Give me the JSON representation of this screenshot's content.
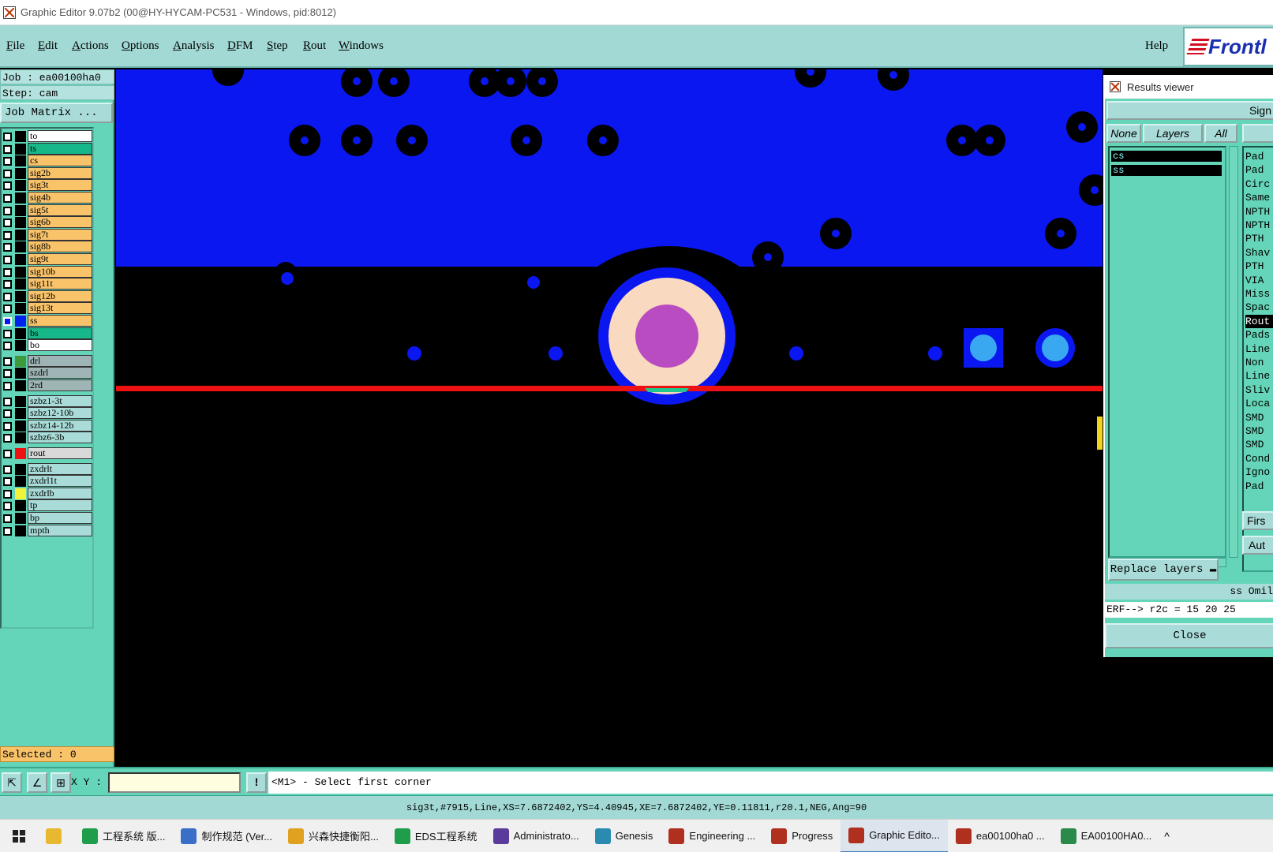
{
  "window": {
    "title": "Graphic Editor 9.07b2 (00@HY-HYCAM-PC531 - Windows, pid:8012)"
  },
  "menu": {
    "items": [
      "File",
      "Edit",
      "Actions",
      "Options",
      "Analysis",
      "DFM",
      "Step",
      "Rout",
      "Windows"
    ],
    "help": "Help",
    "brand": "Frontl"
  },
  "left_panel": {
    "job": "Job : ea00100ha0",
    "step": "Step: cam",
    "job_matrix": "Job Matrix ...",
    "selected": "Selected : 0",
    "layers": [
      {
        "name": "to",
        "bg": "#ffffff",
        "swatch": "#000000",
        "checked": false
      },
      {
        "name": "ts",
        "bg": "#16b88a",
        "swatch": "#000000",
        "checked": false
      },
      {
        "name": "cs",
        "bg": "#f9c36a",
        "swatch": "#000000",
        "checked": false
      },
      {
        "name": "sig2b",
        "bg": "#f9c36a",
        "swatch": "#000000",
        "checked": false
      },
      {
        "name": "sig3t",
        "bg": "#f9c36a",
        "swatch": "#000000",
        "checked": false
      },
      {
        "name": "sig4b",
        "bg": "#f9c36a",
        "swatch": "#000000",
        "checked": false
      },
      {
        "name": "sig5t",
        "bg": "#f9c36a",
        "swatch": "#000000",
        "checked": false
      },
      {
        "name": "sig6b",
        "bg": "#f9c36a",
        "swatch": "#000000",
        "checked": false
      },
      {
        "name": "sig7t",
        "bg": "#f9c36a",
        "swatch": "#000000",
        "checked": false
      },
      {
        "name": "sig8b",
        "bg": "#f9c36a",
        "swatch": "#000000",
        "checked": false
      },
      {
        "name": "sig9t",
        "bg": "#f9c36a",
        "swatch": "#000000",
        "checked": false
      },
      {
        "name": "sig10b",
        "bg": "#f9c36a",
        "swatch": "#000000",
        "checked": false
      },
      {
        "name": "sig11t",
        "bg": "#f9c36a",
        "swatch": "#000000",
        "checked": false
      },
      {
        "name": "sig12b",
        "bg": "#f9c36a",
        "swatch": "#000000",
        "checked": false
      },
      {
        "name": "sig13t",
        "bg": "#f9c36a",
        "swatch": "#000000",
        "checked": false
      },
      {
        "name": "ss",
        "bg": "#f9c36a",
        "swatch": "#0022ee",
        "checked": true
      },
      {
        "name": "bs",
        "bg": "#16b88a",
        "swatch": "#000000",
        "checked": false
      },
      {
        "name": "bo",
        "bg": "#ffffff",
        "swatch": "#000000",
        "checked": false
      },
      {
        "name": "drl",
        "bg": "#9fb5b5",
        "swatch": "#3c9a3c",
        "checked": false
      },
      {
        "name": "szdrl",
        "bg": "#9fb5b5",
        "swatch": "#000000",
        "checked": false
      },
      {
        "name": "2rd",
        "bg": "#9fb5b5",
        "swatch": "#000000",
        "checked": false
      },
      {
        "name": "szbz1-3t",
        "bg": "#a9dcd8",
        "swatch": "#000000",
        "checked": false
      },
      {
        "name": "szbz12-10b",
        "bg": "#a9dcd8",
        "swatch": "#000000",
        "checked": false
      },
      {
        "name": "szbz14-12b",
        "bg": "#a9dcd8",
        "swatch": "#000000",
        "checked": false
      },
      {
        "name": "szbz6-3b",
        "bg": "#a9dcd8",
        "swatch": "#000000",
        "checked": false
      },
      {
        "name": "rout",
        "bg": "#d9d9d9",
        "swatch": "#ee1111",
        "checked": false
      },
      {
        "name": "zxdrlt",
        "bg": "#a9dcd8",
        "swatch": "#000000",
        "checked": false
      },
      {
        "name": "zxdrl1t",
        "bg": "#a9dcd8",
        "swatch": "#000000",
        "checked": false
      },
      {
        "name": "zxdrlb",
        "bg": "#a9dcd8",
        "swatch": "#f2f23a",
        "checked": false
      },
      {
        "name": "tp",
        "bg": "#a9dcd8",
        "swatch": "#000000",
        "checked": false
      },
      {
        "name": "bp",
        "bg": "#a9dcd8",
        "swatch": "#000000",
        "checked": false
      },
      {
        "name": "mpth",
        "bg": "#a9dcd8",
        "swatch": "#000000",
        "checked": false
      }
    ]
  },
  "results_viewer": {
    "title": "Results viewer",
    "sign_button": "Sign",
    "none_button": "None",
    "layers_button": "Layers",
    "all_button": "All",
    "layer_items": [
      "cs",
      "ss"
    ],
    "checks": [
      "Pad",
      "Pad",
      "Circ",
      "Same",
      "NPTH",
      "NPTH",
      "PTH",
      "Shav",
      "PTH",
      "VIA",
      "Miss",
      "Spac",
      "Rout",
      "Pads",
      "Line",
      "Non",
      "Line",
      "Sliv",
      "Loca",
      "SMD",
      "SMD",
      "SMD",
      "Cond",
      "Igno",
      "Pad"
    ],
    "first_button": "Firs",
    "auto_button": "Aut",
    "replace_layers": "Replace layers",
    "status": "ss  Omil",
    "erf": "ERF--> r2c = 15 20 25",
    "close": "Close"
  },
  "command": {
    "xy_label": "X Y :",
    "xy_value": "",
    "warn": "!",
    "prompt": "<M1> - Select first corner"
  },
  "status_bar": {
    "text": "sig3t,#7915,Line,XS=7.6872402,YS=4.40945,XE=7.6872402,YE=0.11811,r20.1,NEG,Ang=90"
  },
  "taskbar": {
    "items": [
      {
        "label": "工程系统  版...",
        "icon_color": "#1e9e4a"
      },
      {
        "label": "制作规范 (Ver...",
        "icon_color": "#3a6fc7"
      },
      {
        "label": "兴森快捷衡阳...",
        "icon_color": "#e0a020"
      },
      {
        "label": "EDS工程系统",
        "icon_color": "#1e9e4a"
      },
      {
        "label": "Administrato...",
        "icon_color": "#5a3a9a"
      },
      {
        "label": "Genesis",
        "icon_color": "#2a8ab0"
      },
      {
        "label": "Engineering ...",
        "icon_color": "#b03020"
      },
      {
        "label": "Progress",
        "icon_color": "#b03020"
      },
      {
        "label": "Graphic Edito...",
        "icon_color": "#b03020",
        "active": true
      },
      {
        "label": "ea00100ha0 ...",
        "icon_color": "#b03020"
      },
      {
        "label": "EA00100HA0...",
        "icon_color": "#2a8a4a"
      }
    ],
    "tray_chevron": "^"
  },
  "colors": {
    "canvas_bg": "#000000",
    "copper_blue": "#0a17f0",
    "rout_line": "#ee1111",
    "pad_peach": "#f9d9c0",
    "pad_purple": "#b94cc0",
    "light_blue": "#3aa8f0",
    "panel_teal": "#64d5b8"
  }
}
